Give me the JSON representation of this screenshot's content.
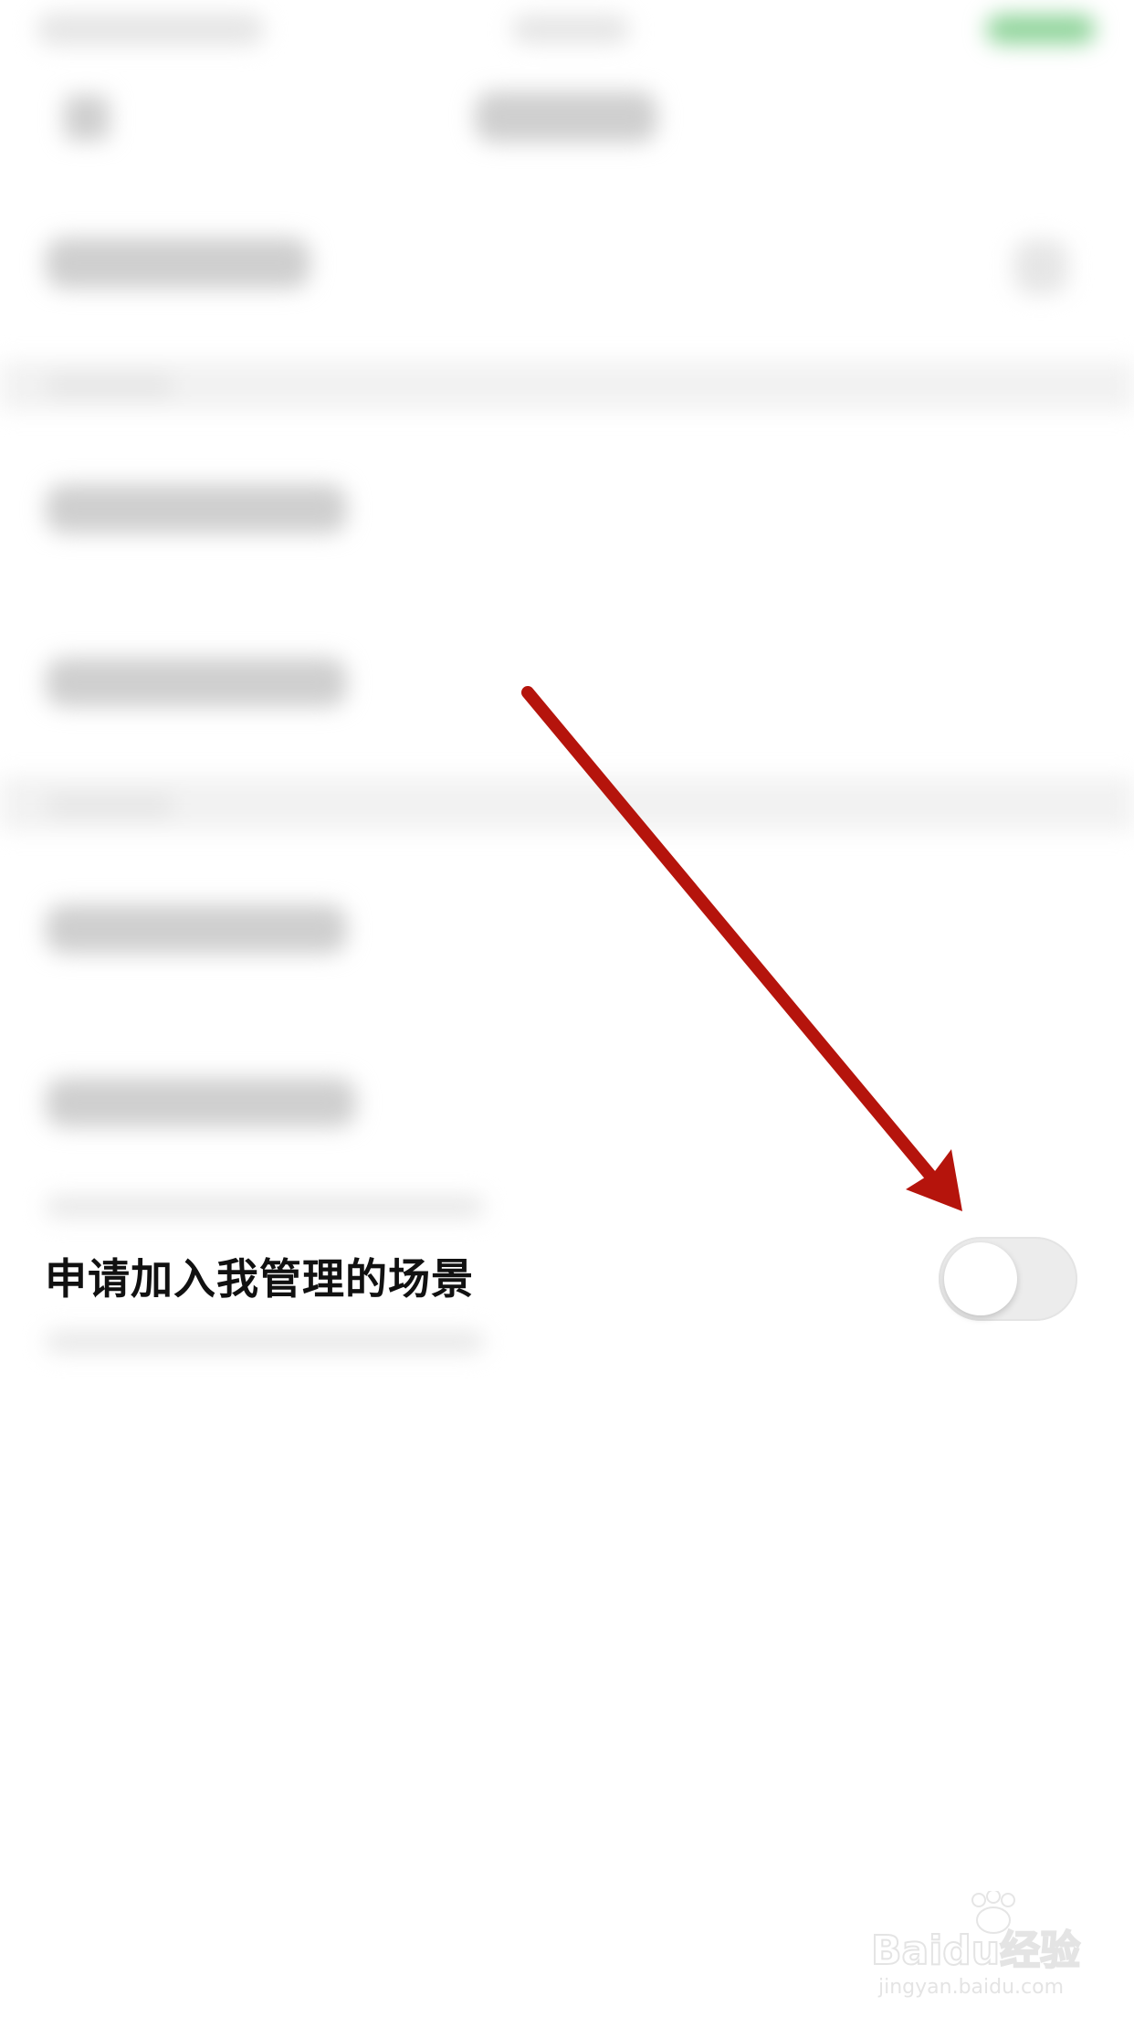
{
  "setting_row": {
    "label": "申请加入我管理的场景",
    "toggle_on": false
  },
  "colors": {
    "arrow": "#b5140c",
    "toggle_track_off": "#ececec",
    "text": "#111111"
  },
  "watermark": {
    "logo_text": "Baidu经验",
    "domain": "jingyan.baidu.com"
  }
}
